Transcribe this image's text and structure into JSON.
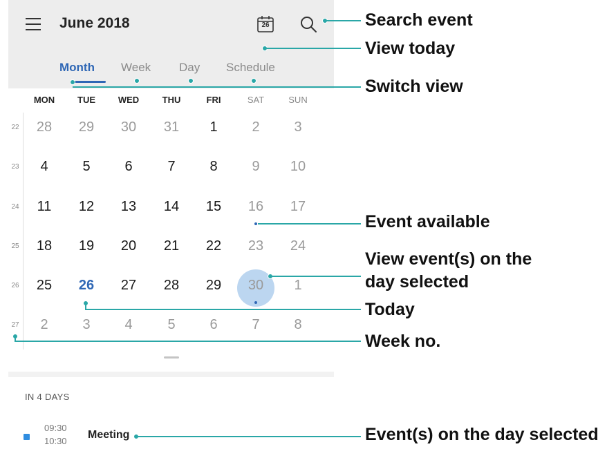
{
  "header": {
    "title": "June 2018",
    "today_icon_day": "26",
    "tabs": [
      {
        "label": "Month",
        "active": true
      },
      {
        "label": "Week",
        "active": false
      },
      {
        "label": "Day",
        "active": false
      },
      {
        "label": "Schedule",
        "active": false
      }
    ]
  },
  "calendar": {
    "weekdays": [
      "MON",
      "TUE",
      "WED",
      "THU",
      "FRI",
      "SAT",
      "SUN"
    ],
    "weeks": [
      {
        "no": "22",
        "days": [
          "28",
          "29",
          "30",
          "31",
          "1",
          "2",
          "3"
        ]
      },
      {
        "no": "23",
        "days": [
          "4",
          "5",
          "6",
          "7",
          "8",
          "9",
          "10"
        ]
      },
      {
        "no": "24",
        "days": [
          "11",
          "12",
          "13",
          "14",
          "15",
          "16",
          "17"
        ]
      },
      {
        "no": "25",
        "days": [
          "18",
          "19",
          "20",
          "21",
          "22",
          "23",
          "24"
        ]
      },
      {
        "no": "26",
        "days": [
          "25",
          "26",
          "27",
          "28",
          "29",
          "30",
          "1"
        ]
      },
      {
        "no": "27",
        "days": [
          "2",
          "3",
          "4",
          "5",
          "6",
          "7",
          "8"
        ]
      }
    ],
    "today": "26",
    "selected": "30"
  },
  "events": {
    "heading": "IN 4 DAYS",
    "items": [
      {
        "start": "09:30",
        "end": "10:30",
        "title": "Meeting",
        "color": "#2f8de0"
      }
    ]
  },
  "annotations": {
    "search_event": "Search event",
    "view_today": "View today",
    "switch_view": "Switch view",
    "event_available": "Event available",
    "view_events_line1": "View event(s) on the",
    "view_events_line2": "day selected",
    "today": "Today",
    "week_no": "Week no.",
    "events_on_day": "Event(s) on the day selected"
  },
  "colors": {
    "accent": "#2f67b5",
    "callout_line": "#2aa7a7",
    "selected_circle": "#bcd6f0",
    "header_bg": "#ededed"
  }
}
